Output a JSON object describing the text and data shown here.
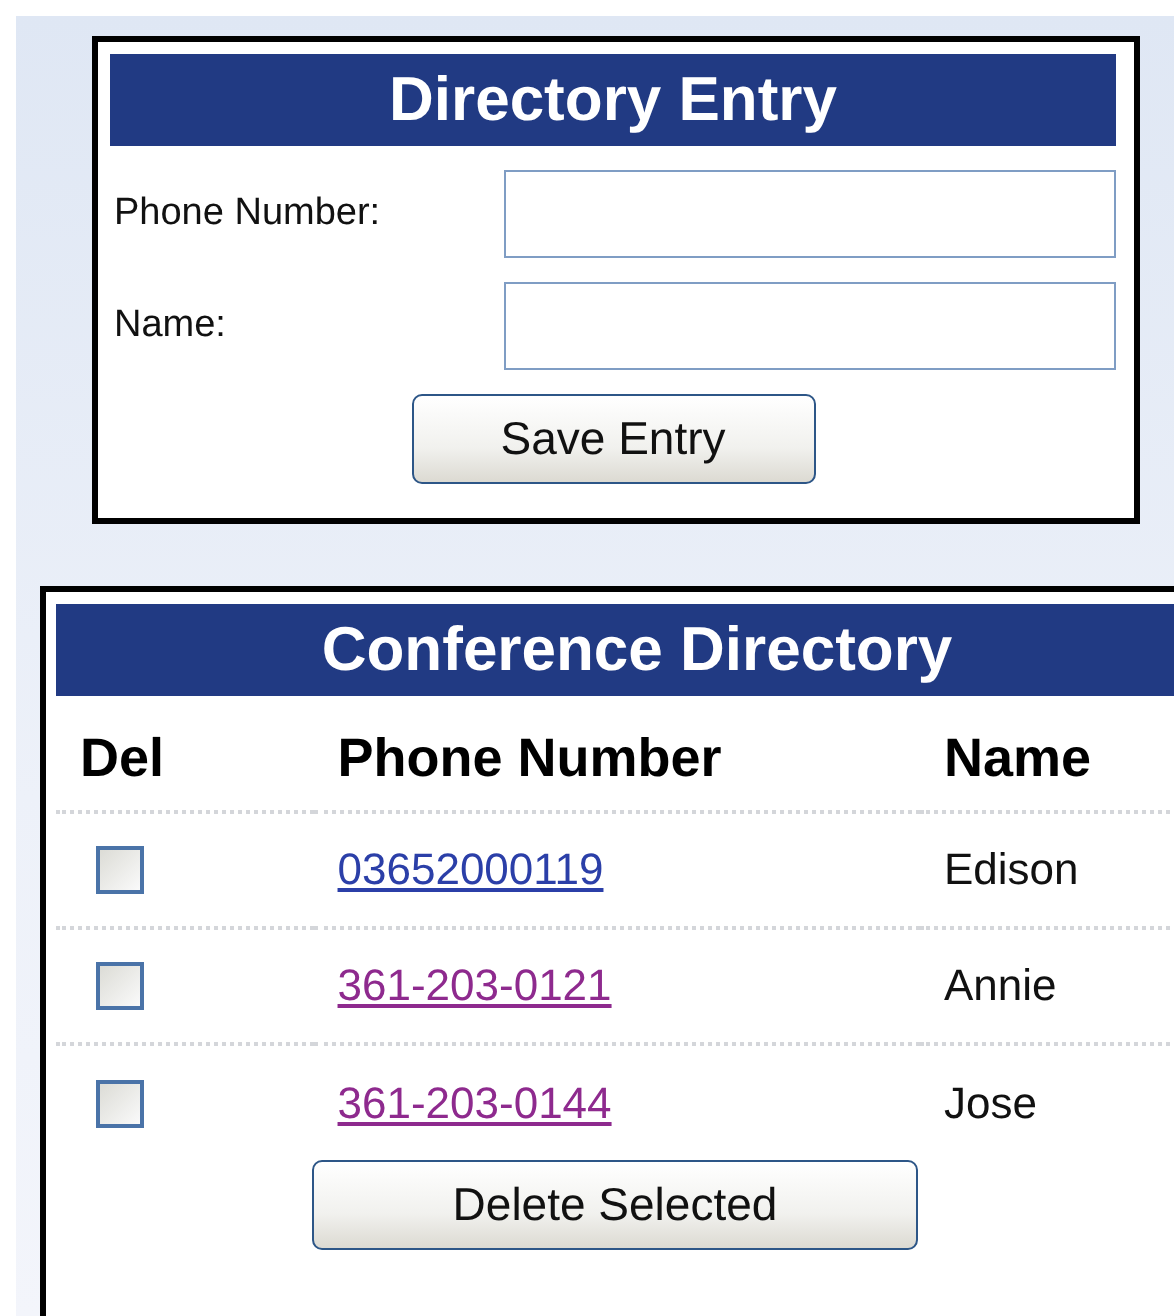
{
  "entry_form": {
    "title": "Directory Entry",
    "fields": [
      {
        "label": "Phone Number:"
      },
      {
        "label": "Name:"
      }
    ],
    "button": "Save Entry"
  },
  "directory": {
    "title": "Conference Directory",
    "columns": [
      "Del",
      "Phone Number",
      "Name"
    ],
    "rows": [
      {
        "checked": false,
        "phone": "03652000119",
        "visited": false,
        "name": "Edison"
      },
      {
        "checked": false,
        "phone": "361-203-0121",
        "visited": true,
        "name": "Annie"
      },
      {
        "checked": false,
        "phone": "361-203-0144",
        "visited": true,
        "name": "Jose"
      }
    ],
    "button": "Delete Selected"
  }
}
